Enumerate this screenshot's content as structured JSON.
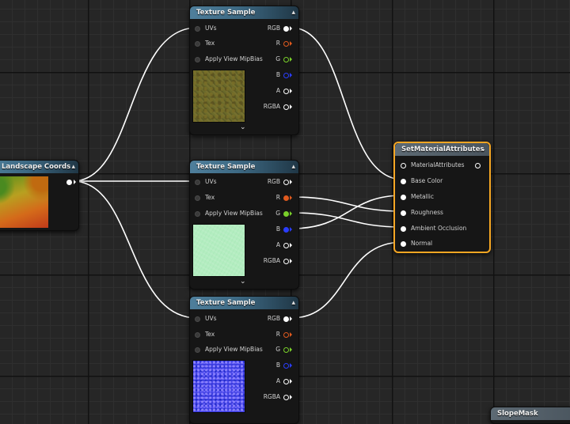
{
  "landscape_coords": {
    "title": "Landscape Coords"
  },
  "texture_samples": [
    {
      "title": "Texture Sample",
      "inputs": [
        "UVs",
        "Tex",
        "Apply View MipBias"
      ],
      "outputs": [
        "RGB",
        "R",
        "G",
        "B",
        "A",
        "RGBA"
      ]
    },
    {
      "title": "Texture Sample",
      "inputs": [
        "UVs",
        "Tex",
        "Apply View MipBias"
      ],
      "outputs": [
        "RGB",
        "R",
        "G",
        "B",
        "A",
        "RGBA"
      ]
    },
    {
      "title": "Texture Sample",
      "inputs": [
        "UVs",
        "Tex",
        "Apply View MipBias"
      ],
      "outputs": [
        "RGB",
        "R",
        "G",
        "B",
        "A",
        "RGBA"
      ]
    }
  ],
  "set_material_attributes": {
    "title": "SetMaterialAttributes",
    "pins": [
      "MaterialAttributes",
      "Base Color",
      "Metallic",
      "Roughness",
      "Ambient Occlusion",
      "Normal"
    ]
  },
  "slope_mask": {
    "title": "SlopeMask"
  },
  "icons": {
    "collapse": "chevron-up-icon",
    "expand": "chevron-down-icon",
    "dropdown": "chevron-down-icon"
  },
  "colors": {
    "accent_selected": "#f5a623",
    "pin_red": "#e05a1e",
    "pin_green": "#7ad02a",
    "pin_blue": "#2a3dff",
    "header_blue": "#3d6983",
    "grid_bg": "#262626"
  }
}
